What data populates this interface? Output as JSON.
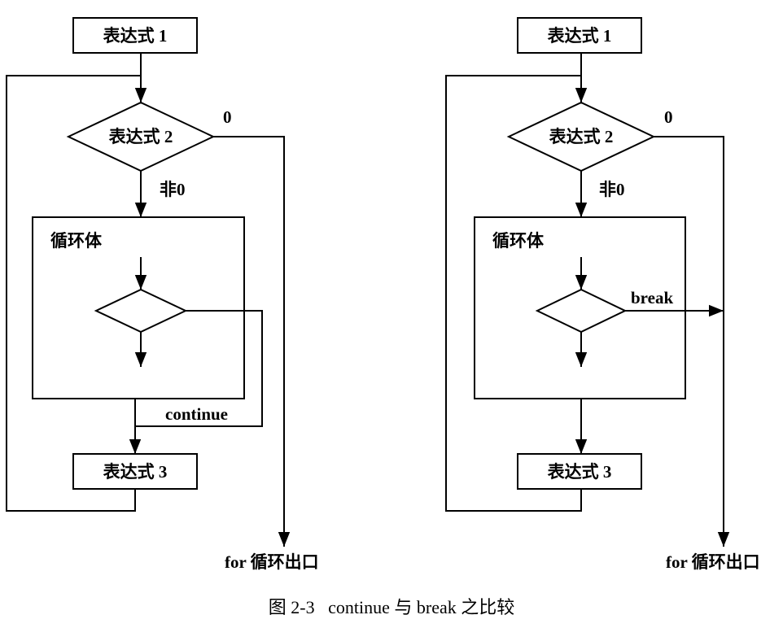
{
  "left": {
    "expr1": "表达式 1",
    "expr2": "表达式 2",
    "expr3": "表达式 3",
    "zero": "0",
    "nonzero": "非0",
    "loop_body": "循环体",
    "jump": "continue",
    "exit": "for 循环出口"
  },
  "right": {
    "expr1": "表达式 1",
    "expr2": "表达式 2",
    "expr3": "表达式 3",
    "zero": "0",
    "nonzero": "非0",
    "loop_body": "循环体",
    "jump": "break",
    "exit": "for 循环出口"
  },
  "caption": "图 2-3   continue 与 break 之比较"
}
